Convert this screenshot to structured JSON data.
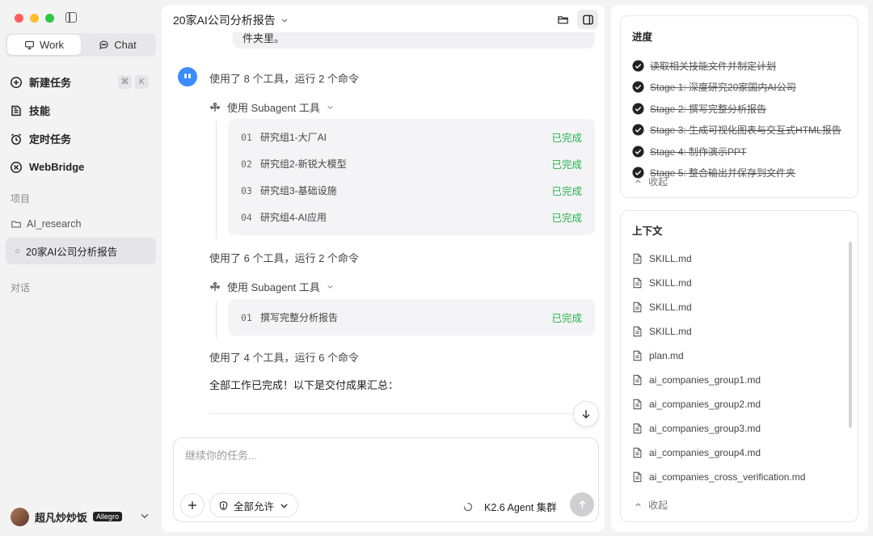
{
  "sidebar": {
    "modes": [
      {
        "label": "Work",
        "icon": "monitor-icon",
        "active": true
      },
      {
        "label": "Chat",
        "icon": "chat-bubble-icon",
        "active": false
      }
    ],
    "nav": [
      {
        "label": "新建任务",
        "icon": "new-task-icon",
        "shortcut": [
          "⌘",
          "K"
        ]
      },
      {
        "label": "技能",
        "icon": "skills-icon"
      },
      {
        "label": "定时任务",
        "icon": "alarm-clock-icon"
      },
      {
        "label": "WebBridge",
        "icon": "webbridge-icon"
      }
    ],
    "projects_label": "项目",
    "project_folder": "AI_research",
    "active_chat": "20家AI公司分析报告",
    "conversations_label": "对话",
    "user": {
      "name": "超凡炒炒饭",
      "badge": "Allegro"
    }
  },
  "main": {
    "title": "20家AI公司分析报告",
    "prev_message_tail": "件夹里。",
    "steps": [
      {
        "summary": "使用了 8 个工具，运行 2 个命令",
        "tool_label": "使用 Subagent 工具",
        "tasks": [
          {
            "num": "01",
            "name": "研究组1-大厂AI",
            "status": "已完成"
          },
          {
            "num": "02",
            "name": "研究组2-新锐大模型",
            "status": "已完成"
          },
          {
            "num": "03",
            "name": "研究组3-基础设施",
            "status": "已完成"
          },
          {
            "num": "04",
            "name": "研究组4-AI应用",
            "status": "已完成"
          }
        ]
      },
      {
        "summary": "使用了 6 个工具，运行 2 个命令",
        "tool_label": "使用 Subagent 工具",
        "tasks": [
          {
            "num": "01",
            "name": "撰写完整分析报告",
            "status": "已完成"
          }
        ]
      }
    ],
    "step3_summary": "使用了 4 个工具，运行 6 个命令",
    "final_message": "全部工作已完成！以下是交付成果汇总：",
    "composer": {
      "placeholder": "继续你的任务...",
      "permission": "全部允许",
      "agent": "K2.6 Agent 集群"
    }
  },
  "right": {
    "progress": {
      "title": "进度",
      "items": [
        "读取相关技能文件并制定计划",
        "Stage 1: 深度研究20家国内AI公司",
        "Stage 2: 撰写完整分析报告",
        "Stage 3: 生成可视化图表与交互式HTML报告",
        "Stage 4: 制作演示PPT",
        "Stage 5: 整合输出并保存到文件夹"
      ],
      "collapse": "收起"
    },
    "context": {
      "title": "上下文",
      "files": [
        "SKILL.md",
        "SKILL.md",
        "SKILL.md",
        "SKILL.md",
        "plan.md",
        "ai_companies_group1.md",
        "ai_companies_group2.md",
        "ai_companies_group3.md",
        "ai_companies_group4.md",
        "ai_companies_cross_verification.md"
      ],
      "collapse": "收起"
    }
  },
  "colors": {
    "status_done": "#22b14c",
    "bot_avatar": "#3a8dff"
  }
}
